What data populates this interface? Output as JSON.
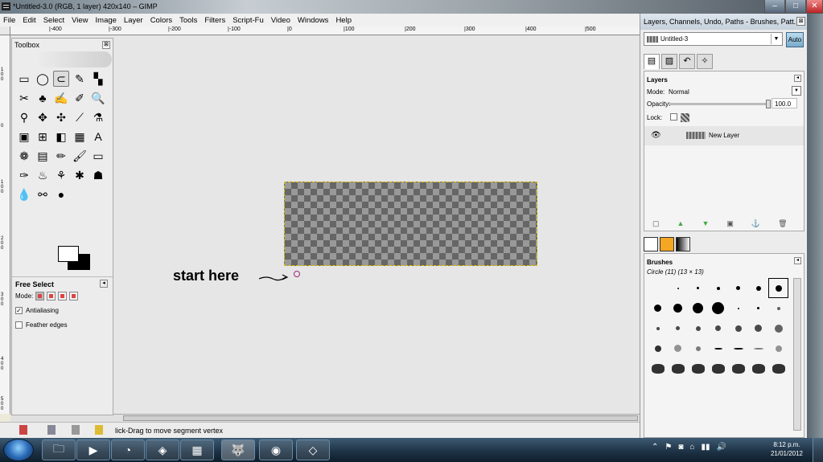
{
  "window": {
    "title": "*Untitled-3.0 (RGB, 1 layer) 420x140 – GIMP",
    "min": "–",
    "max": "□",
    "close": "✕"
  },
  "menu": [
    "File",
    "Edit",
    "Select",
    "View",
    "Image",
    "Layer",
    "Colors",
    "Tools",
    "Filters",
    "Script-Fu",
    "Video",
    "Windows",
    "Help"
  ],
  "ruler": {
    "labels": [
      "|-400",
      "|-300",
      "|-200",
      "|-100",
      "|0",
      "|100",
      "|200",
      "|300",
      "|400",
      "|500"
    ],
    "left_labels": [
      "100",
      "0",
      "100",
      "200",
      "300",
      "400",
      "500"
    ]
  },
  "annotation": "start here",
  "status": {
    "message": "lick-Drag to move segment vertex"
  },
  "toolbox": {
    "title": "Toolbox",
    "close": "⊠",
    "tools": [
      "▭",
      "◯",
      "⊂",
      "✎",
      "▚",
      "✂",
      "♣",
      "✍",
      "✐",
      "🔍",
      "⚲",
      "✥",
      "✣",
      "⟋",
      "⚗",
      "▣",
      "⊞",
      "◧",
      "▦",
      "A",
      "❁",
      "▤",
      "✏",
      "🖌",
      "▭",
      "✑",
      "♨",
      "⚘",
      "✱",
      "☗",
      "💧",
      "⚯",
      "●"
    ],
    "options": {
      "title": "Free Select",
      "mode_label": "Mode:",
      "antialiasing": "Antialiasing",
      "feather": "Feather edges",
      "check": "✓"
    }
  },
  "dock": {
    "title": "Layers, Channels, Undo, Paths - Brushes, Patt...",
    "close": "⊠",
    "image": "Untitled-3",
    "auto": "Auto",
    "dd": "▼",
    "tabs": [
      "▤",
      "▨",
      "↶",
      "✧"
    ],
    "layers": {
      "title": "Layers",
      "mode_label": "Mode:",
      "mode_value": "Normal",
      "opacity_label": "Opacity:",
      "opacity_value": "100.0",
      "lock_label": "Lock:",
      "layer_name": "New Layer",
      "eye": "👁",
      "buttons": [
        "▢",
        "▲",
        "▼",
        "▣",
        "⚓",
        "🗑"
      ],
      "x": "◂"
    },
    "brushes": {
      "title": "Brushes",
      "selected": "Circle (11) (13 × 13)",
      "x": "◂"
    }
  },
  "taskbar": {
    "apps": [
      "🗀",
      "▶",
      "◔",
      "◈",
      "▦",
      "🐺",
      "◉",
      "◇"
    ],
    "tray": [
      "⌃",
      "⚑",
      "◙",
      "⌂",
      "▮▮",
      "🔊"
    ],
    "time": "8:12 p.m.",
    "date": "21/01/2012"
  },
  "colors": {
    "selection": "#e0c000",
    "annotation_circle": "#a0287a"
  }
}
